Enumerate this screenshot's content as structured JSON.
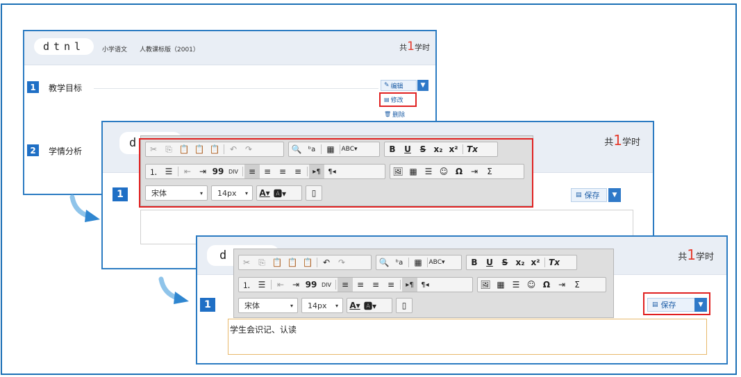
{
  "panel1": {
    "logo": "dtnl",
    "subject": "小学语文",
    "edition": "人教课标版（2001）",
    "lesson_prefix": "共",
    "lesson_count": "1",
    "lesson_suffix": "学时",
    "sections": [
      {
        "num": "1",
        "title": "教学目标"
      },
      {
        "num": "2",
        "title": "学情分析"
      }
    ],
    "menu": {
      "edit": "编辑",
      "modify": "修改",
      "delete": "删除"
    }
  },
  "panel2": {
    "logo": "d",
    "lesson_prefix": "共",
    "lesson_count": "1",
    "lesson_suffix": "学时",
    "section_num": "1",
    "save": "保存",
    "font_family": "宋体",
    "font_size": "14px"
  },
  "panel3": {
    "logo": "d",
    "lesson_prefix": "共",
    "lesson_count": "1",
    "lesson_suffix": "学时",
    "section_num": "1",
    "save": "保存",
    "font_family": "宋体",
    "font_size": "14px",
    "editor_text": "学生会识记、认读"
  },
  "colors": {
    "accent": "#1f6fc5",
    "highlight": "#e02020",
    "count": "#e53a2c",
    "editor_border": "#e8b86a"
  }
}
